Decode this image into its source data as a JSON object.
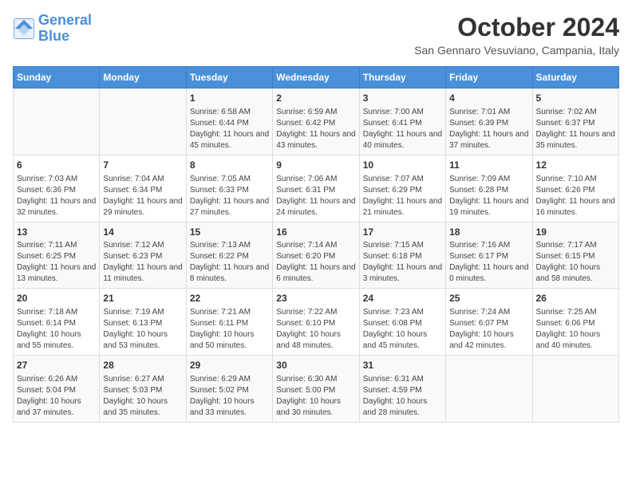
{
  "header": {
    "logo_line1": "General",
    "logo_line2": "Blue",
    "month_title": "October 2024",
    "subtitle": "San Gennaro Vesuviano, Campania, Italy"
  },
  "days_of_week": [
    "Sunday",
    "Monday",
    "Tuesday",
    "Wednesday",
    "Thursday",
    "Friday",
    "Saturday"
  ],
  "weeks": [
    [
      {
        "day": "",
        "info": ""
      },
      {
        "day": "",
        "info": ""
      },
      {
        "day": "1",
        "info": "Sunrise: 6:58 AM\nSunset: 6:44 PM\nDaylight: 11 hours and 45 minutes."
      },
      {
        "day": "2",
        "info": "Sunrise: 6:59 AM\nSunset: 6:42 PM\nDaylight: 11 hours and 43 minutes."
      },
      {
        "day": "3",
        "info": "Sunrise: 7:00 AM\nSunset: 6:41 PM\nDaylight: 11 hours and 40 minutes."
      },
      {
        "day": "4",
        "info": "Sunrise: 7:01 AM\nSunset: 6:39 PM\nDaylight: 11 hours and 37 minutes."
      },
      {
        "day": "5",
        "info": "Sunrise: 7:02 AM\nSunset: 6:37 PM\nDaylight: 11 hours and 35 minutes."
      }
    ],
    [
      {
        "day": "6",
        "info": "Sunrise: 7:03 AM\nSunset: 6:36 PM\nDaylight: 11 hours and 32 minutes."
      },
      {
        "day": "7",
        "info": "Sunrise: 7:04 AM\nSunset: 6:34 PM\nDaylight: 11 hours and 29 minutes."
      },
      {
        "day": "8",
        "info": "Sunrise: 7:05 AM\nSunset: 6:33 PM\nDaylight: 11 hours and 27 minutes."
      },
      {
        "day": "9",
        "info": "Sunrise: 7:06 AM\nSunset: 6:31 PM\nDaylight: 11 hours and 24 minutes."
      },
      {
        "day": "10",
        "info": "Sunrise: 7:07 AM\nSunset: 6:29 PM\nDaylight: 11 hours and 21 minutes."
      },
      {
        "day": "11",
        "info": "Sunrise: 7:09 AM\nSunset: 6:28 PM\nDaylight: 11 hours and 19 minutes."
      },
      {
        "day": "12",
        "info": "Sunrise: 7:10 AM\nSunset: 6:26 PM\nDaylight: 11 hours and 16 minutes."
      }
    ],
    [
      {
        "day": "13",
        "info": "Sunrise: 7:11 AM\nSunset: 6:25 PM\nDaylight: 11 hours and 13 minutes."
      },
      {
        "day": "14",
        "info": "Sunrise: 7:12 AM\nSunset: 6:23 PM\nDaylight: 11 hours and 11 minutes."
      },
      {
        "day": "15",
        "info": "Sunrise: 7:13 AM\nSunset: 6:22 PM\nDaylight: 11 hours and 8 minutes."
      },
      {
        "day": "16",
        "info": "Sunrise: 7:14 AM\nSunset: 6:20 PM\nDaylight: 11 hours and 6 minutes."
      },
      {
        "day": "17",
        "info": "Sunrise: 7:15 AM\nSunset: 6:18 PM\nDaylight: 11 hours and 3 minutes."
      },
      {
        "day": "18",
        "info": "Sunrise: 7:16 AM\nSunset: 6:17 PM\nDaylight: 11 hours and 0 minutes."
      },
      {
        "day": "19",
        "info": "Sunrise: 7:17 AM\nSunset: 6:15 PM\nDaylight: 10 hours and 58 minutes."
      }
    ],
    [
      {
        "day": "20",
        "info": "Sunrise: 7:18 AM\nSunset: 6:14 PM\nDaylight: 10 hours and 55 minutes."
      },
      {
        "day": "21",
        "info": "Sunrise: 7:19 AM\nSunset: 6:13 PM\nDaylight: 10 hours and 53 minutes."
      },
      {
        "day": "22",
        "info": "Sunrise: 7:21 AM\nSunset: 6:11 PM\nDaylight: 10 hours and 50 minutes."
      },
      {
        "day": "23",
        "info": "Sunrise: 7:22 AM\nSunset: 6:10 PM\nDaylight: 10 hours and 48 minutes."
      },
      {
        "day": "24",
        "info": "Sunrise: 7:23 AM\nSunset: 6:08 PM\nDaylight: 10 hours and 45 minutes."
      },
      {
        "day": "25",
        "info": "Sunrise: 7:24 AM\nSunset: 6:07 PM\nDaylight: 10 hours and 42 minutes."
      },
      {
        "day": "26",
        "info": "Sunrise: 7:25 AM\nSunset: 6:06 PM\nDaylight: 10 hours and 40 minutes."
      }
    ],
    [
      {
        "day": "27",
        "info": "Sunrise: 6:26 AM\nSunset: 5:04 PM\nDaylight: 10 hours and 37 minutes."
      },
      {
        "day": "28",
        "info": "Sunrise: 6:27 AM\nSunset: 5:03 PM\nDaylight: 10 hours and 35 minutes."
      },
      {
        "day": "29",
        "info": "Sunrise: 6:29 AM\nSunset: 5:02 PM\nDaylight: 10 hours and 33 minutes."
      },
      {
        "day": "30",
        "info": "Sunrise: 6:30 AM\nSunset: 5:00 PM\nDaylight: 10 hours and 30 minutes."
      },
      {
        "day": "31",
        "info": "Sunrise: 6:31 AM\nSunset: 4:59 PM\nDaylight: 10 hours and 28 minutes."
      },
      {
        "day": "",
        "info": ""
      },
      {
        "day": "",
        "info": ""
      }
    ]
  ]
}
